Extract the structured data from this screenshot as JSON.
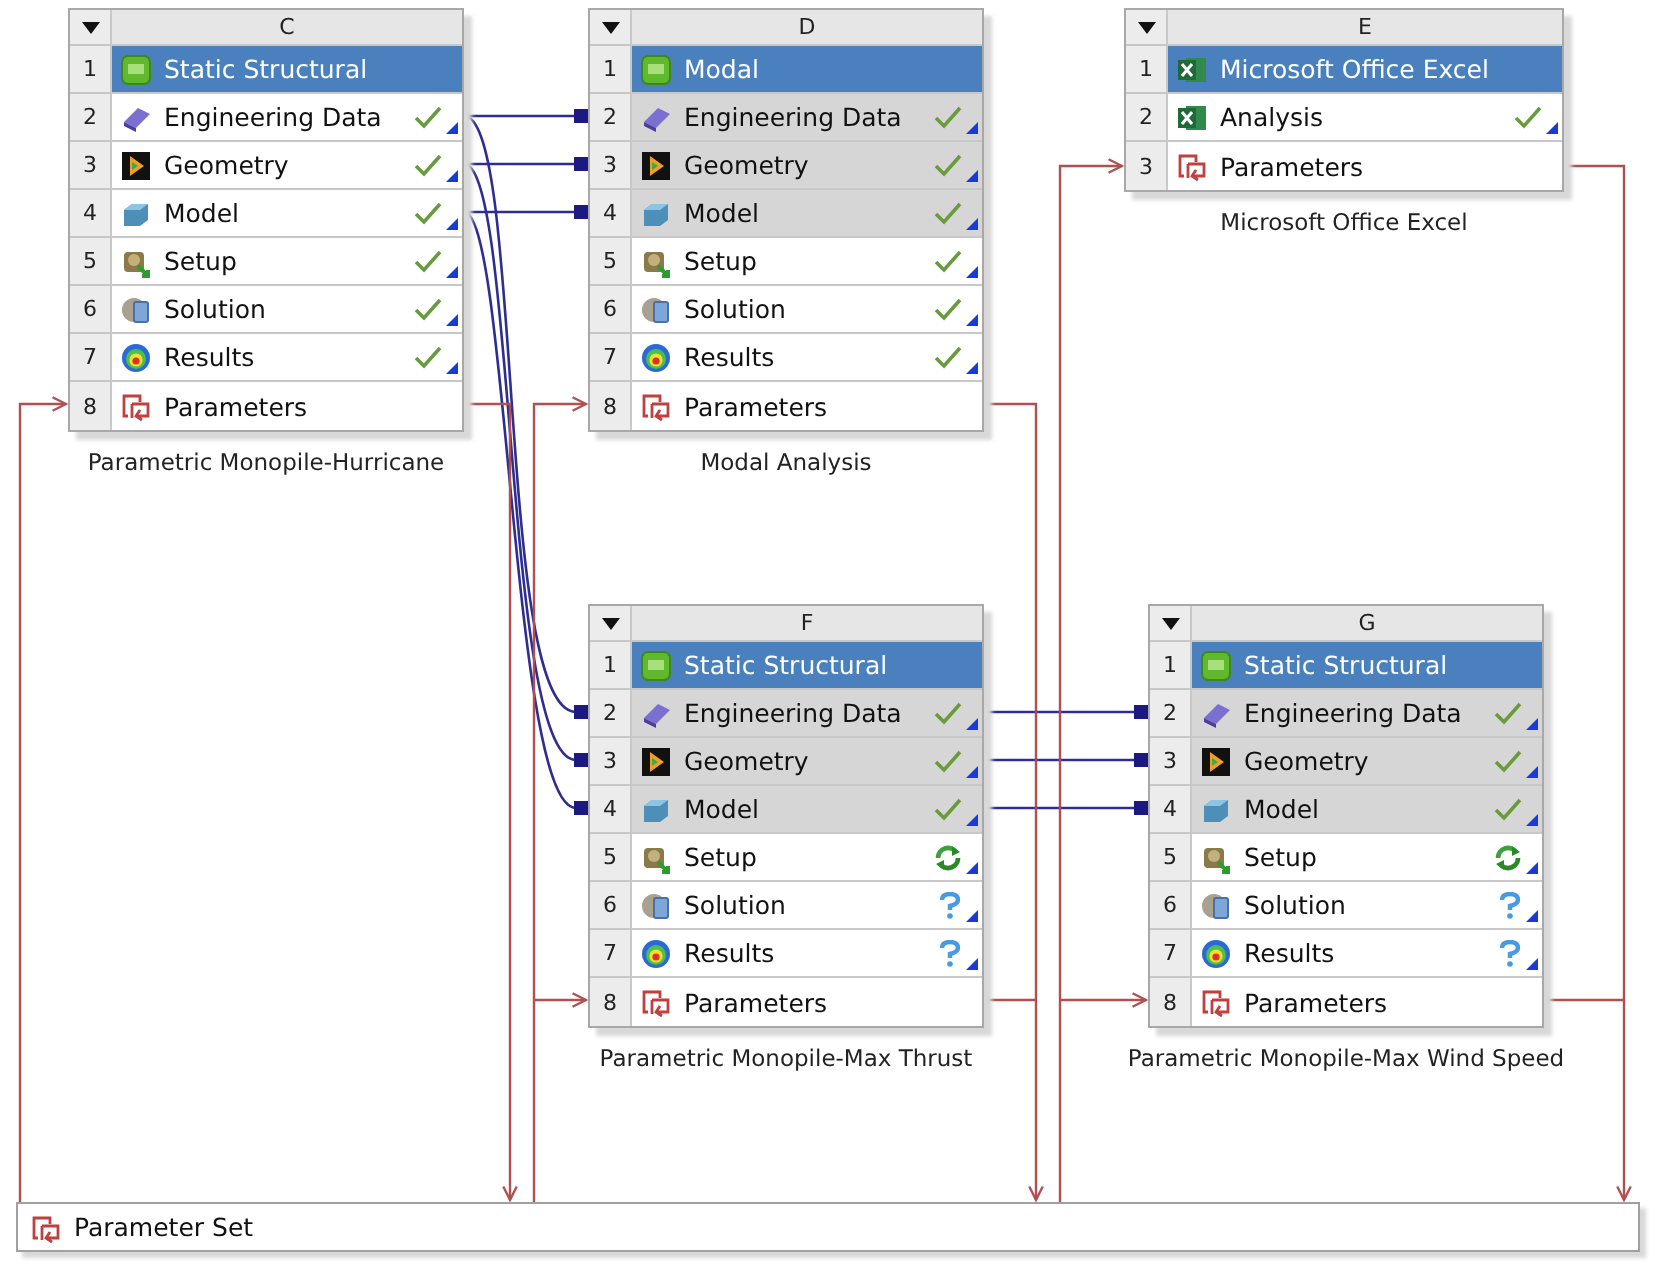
{
  "systems": [
    {
      "letter": "C",
      "title": {
        "number": "1",
        "label": "Static Structural",
        "kind": "static_structural"
      },
      "cells": [
        {
          "number": "2",
          "label": "Engineering Data",
          "kind": "engineering_data",
          "shared": false,
          "up_to_date": true,
          "refresh_required": false,
          "unfulfilled": false
        },
        {
          "number": "3",
          "label": "Geometry",
          "kind": "geometry",
          "shared": false,
          "up_to_date": true,
          "refresh_required": false,
          "unfulfilled": false
        },
        {
          "number": "4",
          "label": "Model",
          "kind": "model",
          "shared": false,
          "up_to_date": true,
          "refresh_required": false,
          "unfulfilled": false
        },
        {
          "number": "5",
          "label": "Setup",
          "kind": "setup",
          "shared": false,
          "up_to_date": true,
          "refresh_required": false,
          "unfulfilled": false
        },
        {
          "number": "6",
          "label": "Solution",
          "kind": "solution",
          "shared": false,
          "up_to_date": true,
          "refresh_required": false,
          "unfulfilled": false
        },
        {
          "number": "7",
          "label": "Results",
          "kind": "results",
          "shared": false,
          "up_to_date": true,
          "refresh_required": false,
          "unfulfilled": false
        },
        {
          "number": "8",
          "label": "Parameters",
          "kind": "parameters"
        }
      ],
      "caption": "Parametric Monopile-Hurricane"
    },
    {
      "letter": "D",
      "title": {
        "number": "1",
        "label": "Modal",
        "kind": "modal"
      },
      "cells": [
        {
          "number": "2",
          "label": "Engineering Data",
          "kind": "engineering_data",
          "shared": true,
          "up_to_date": true,
          "refresh_required": false,
          "unfulfilled": false
        },
        {
          "number": "3",
          "label": "Geometry",
          "kind": "geometry",
          "shared": true,
          "up_to_date": true,
          "refresh_required": false,
          "unfulfilled": false
        },
        {
          "number": "4",
          "label": "Model",
          "kind": "model",
          "shared": true,
          "up_to_date": true,
          "refresh_required": false,
          "unfulfilled": false
        },
        {
          "number": "5",
          "label": "Setup",
          "kind": "setup",
          "shared": false,
          "up_to_date": true,
          "refresh_required": false,
          "unfulfilled": false
        },
        {
          "number": "6",
          "label": "Solution",
          "kind": "solution",
          "shared": false,
          "up_to_date": true,
          "refresh_required": false,
          "unfulfilled": false
        },
        {
          "number": "7",
          "label": "Results",
          "kind": "results",
          "shared": false,
          "up_to_date": true,
          "refresh_required": false,
          "unfulfilled": false
        },
        {
          "number": "8",
          "label": "Parameters",
          "kind": "parameters"
        }
      ],
      "caption": "Modal Analysis"
    },
    {
      "letter": "E",
      "title": {
        "number": "1",
        "label": "Microsoft Office Excel",
        "kind": "excel"
      },
      "cells": [
        {
          "number": "2",
          "label": "Analysis",
          "kind": "excel",
          "shared": false,
          "up_to_date": true,
          "refresh_required": false,
          "unfulfilled": false
        },
        {
          "number": "3",
          "label": "Parameters",
          "kind": "parameters"
        }
      ],
      "caption": "Microsoft Office Excel"
    },
    {
      "letter": "F",
      "title": {
        "number": "1",
        "label": "Static Structural",
        "kind": "static_structural"
      },
      "cells": [
        {
          "number": "2",
          "label": "Engineering Data",
          "kind": "engineering_data",
          "shared": true,
          "up_to_date": true,
          "refresh_required": false,
          "unfulfilled": false
        },
        {
          "number": "3",
          "label": "Geometry",
          "kind": "geometry",
          "shared": true,
          "up_to_date": true,
          "refresh_required": false,
          "unfulfilled": false
        },
        {
          "number": "4",
          "label": "Model",
          "kind": "model",
          "shared": true,
          "up_to_date": true,
          "refresh_required": false,
          "unfulfilled": false
        },
        {
          "number": "5",
          "label": "Setup",
          "kind": "setup",
          "shared": false,
          "up_to_date": false,
          "refresh_required": true,
          "unfulfilled": false
        },
        {
          "number": "6",
          "label": "Solution",
          "kind": "solution",
          "shared": false,
          "up_to_date": false,
          "refresh_required": false,
          "unfulfilled": true
        },
        {
          "number": "7",
          "label": "Results",
          "kind": "results",
          "shared": false,
          "up_to_date": false,
          "refresh_required": false,
          "unfulfilled": true
        },
        {
          "number": "8",
          "label": "Parameters",
          "kind": "parameters"
        }
      ],
      "caption": "Parametric Monopile-Max Thrust"
    },
    {
      "letter": "G",
      "title": {
        "number": "1",
        "label": "Static Structural",
        "kind": "static_structural"
      },
      "cells": [
        {
          "number": "2",
          "label": "Engineering Data",
          "kind": "engineering_data",
          "shared": true,
          "up_to_date": true,
          "refresh_required": false,
          "unfulfilled": false
        },
        {
          "number": "3",
          "label": "Geometry",
          "kind": "geometry",
          "shared": true,
          "up_to_date": true,
          "refresh_required": false,
          "unfulfilled": false
        },
        {
          "number": "4",
          "label": "Model",
          "kind": "model",
          "shared": true,
          "up_to_date": true,
          "refresh_required": false,
          "unfulfilled": false
        },
        {
          "number": "5",
          "label": "Setup",
          "kind": "setup",
          "shared": false,
          "up_to_date": false,
          "refresh_required": true,
          "unfulfilled": false
        },
        {
          "number": "6",
          "label": "Solution",
          "kind": "solution",
          "shared": false,
          "up_to_date": false,
          "refresh_required": false,
          "unfulfilled": true
        },
        {
          "number": "7",
          "label": "Results",
          "kind": "results",
          "shared": false,
          "up_to_date": false,
          "refresh_required": false,
          "unfulfilled": true
        },
        {
          "number": "8",
          "label": "Parameters",
          "kind": "parameters"
        }
      ],
      "caption": "Parametric Monopile-Max Wind Speed"
    }
  ],
  "parameter_set": {
    "label": "Parameter Set"
  }
}
